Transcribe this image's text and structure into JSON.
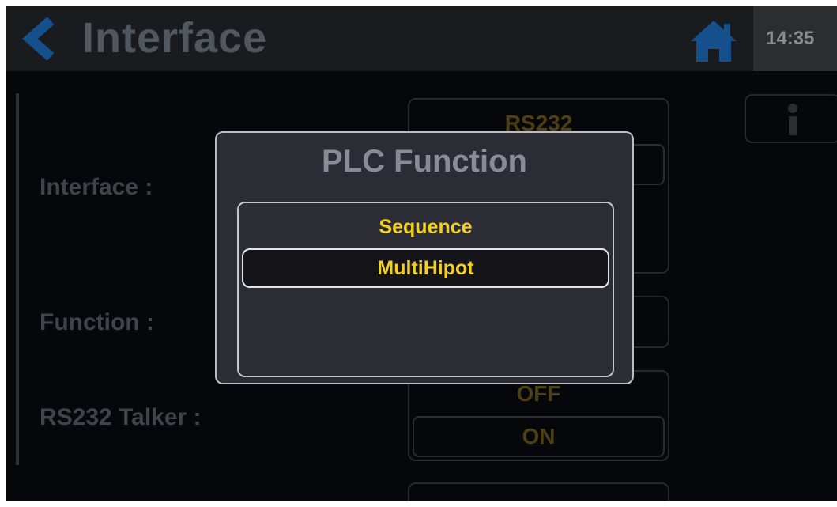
{
  "header": {
    "title": "Interface",
    "time": "14:35",
    "back_icon": "chevron-left-icon",
    "home_icon": "home-icon"
  },
  "form": {
    "interface_label": "Interface :",
    "interface_value": "RS232",
    "function_label": "Function :",
    "talker_label": "RS232 Talker :",
    "talker_options": [
      "OFF",
      "ON"
    ]
  },
  "modal": {
    "title": "PLC Function",
    "options": [
      "Sequence",
      "MultiHipot"
    ],
    "selected": "MultiHipot"
  },
  "colors": {
    "accent_yellow": "#f3cf1f",
    "header_blue": "#1a5fa8",
    "background": "#06070b",
    "modal_bg": "#2c2c35"
  }
}
